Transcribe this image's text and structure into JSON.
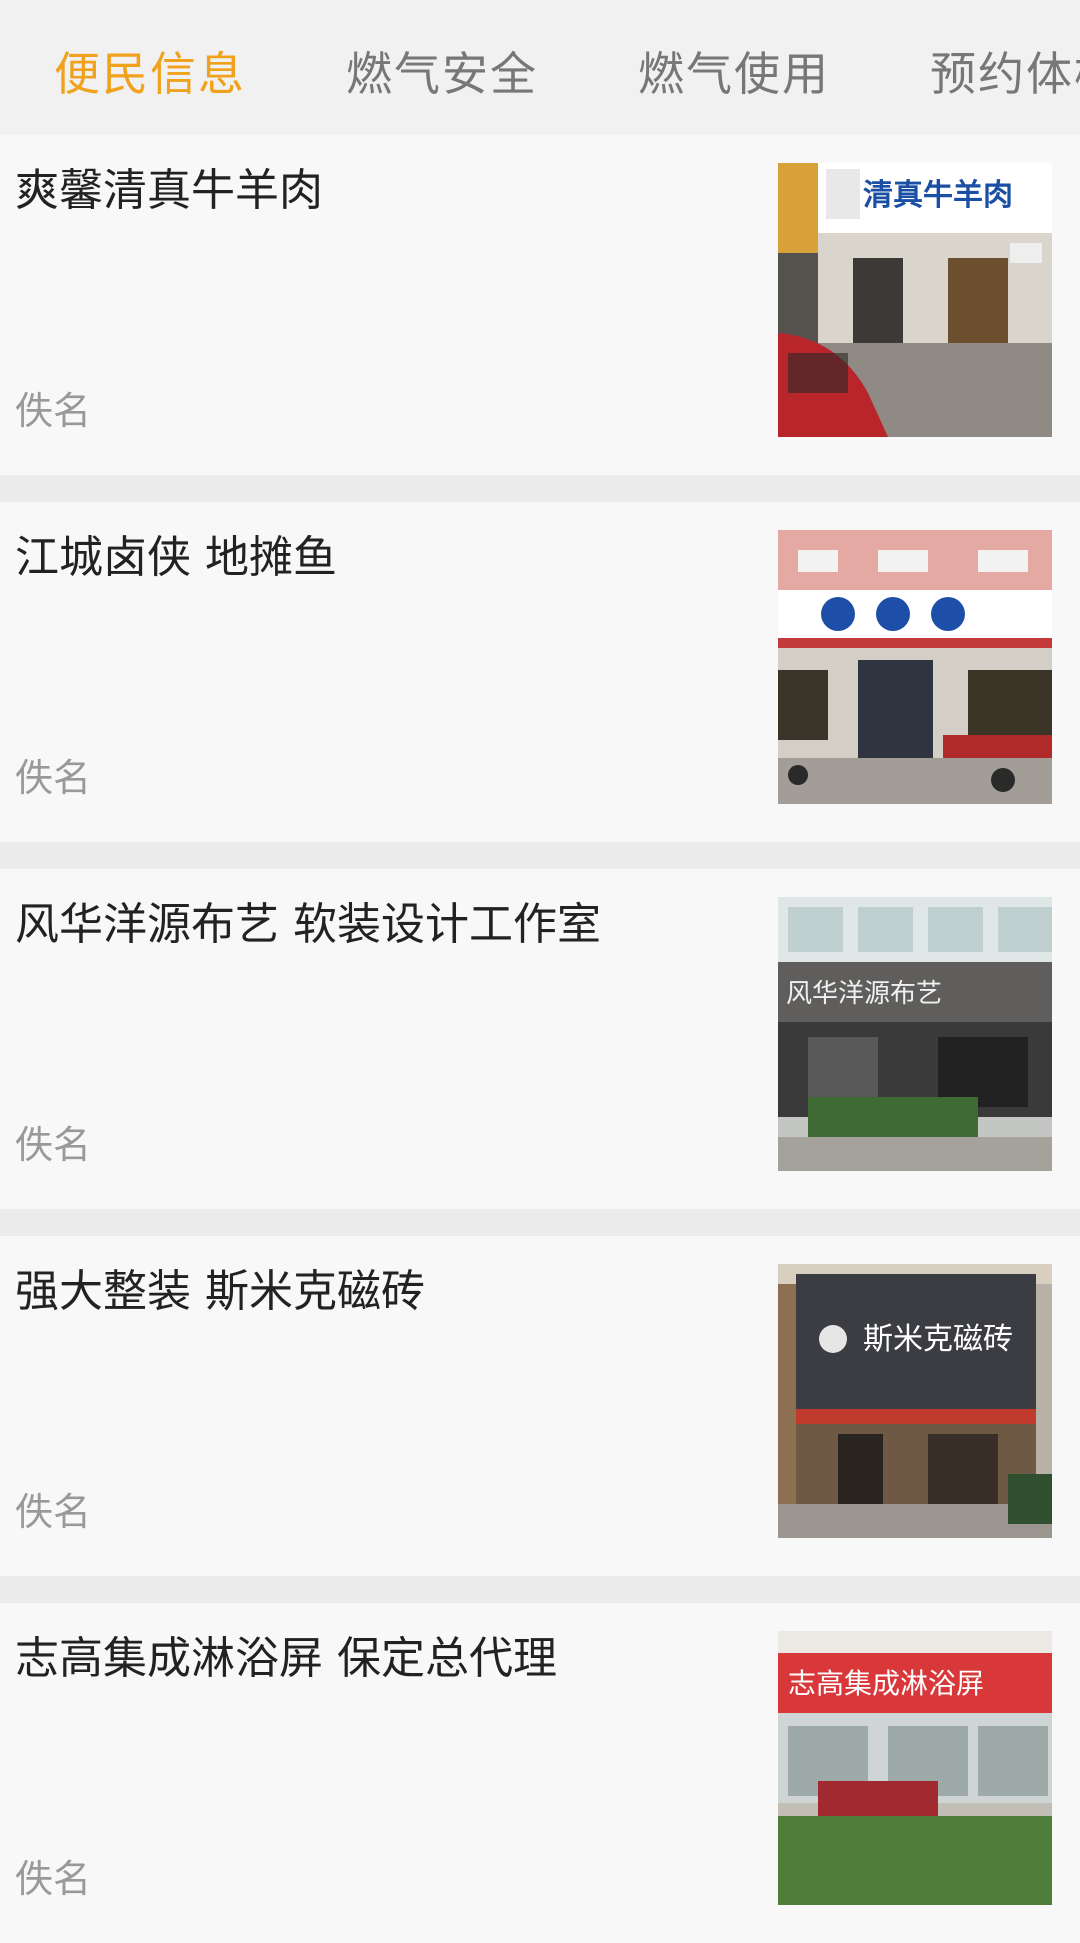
{
  "tabs": [
    {
      "label": "便民信息",
      "active": true
    },
    {
      "label": "燃气安全",
      "active": false
    },
    {
      "label": "燃气使用",
      "active": false
    },
    {
      "label": "预约体检",
      "active": false
    }
  ],
  "colors": {
    "active_tab": "#f0a21c",
    "inactive_tab": "#777777",
    "title": "#222222",
    "author": "#999999"
  },
  "items": [
    {
      "title": "爽馨清真牛羊肉",
      "author": "佚名",
      "image_sign": "清真牛羊肉"
    },
    {
      "title": "江城卤侠 地摊鱼",
      "author": "佚名",
      "image_sign": ""
    },
    {
      "title": "风华洋源布艺 软装设计工作室",
      "author": "佚名",
      "image_sign": "风华洋源布艺"
    },
    {
      "title": "强大整装 斯米克磁砖",
      "author": "佚名",
      "image_sign": "斯米克磁砖"
    },
    {
      "title": "志高集成淋浴屏  保定总代理",
      "author": "佚名",
      "image_sign": "志高集成淋浴屏"
    }
  ]
}
